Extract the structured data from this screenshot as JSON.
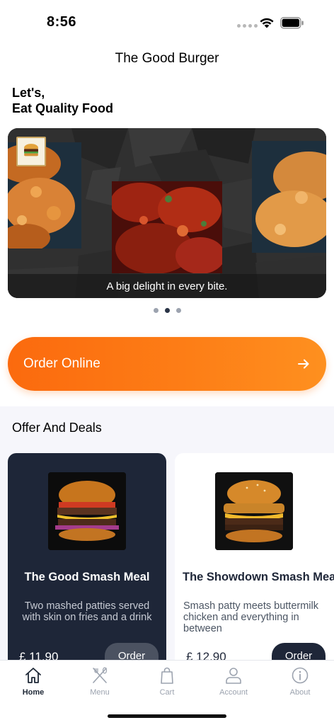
{
  "status_bar": {
    "time": "8:56"
  },
  "header": {
    "title": "The Good Burger"
  },
  "greeting": {
    "line1": "Let's,",
    "line2": "Eat Quality Food"
  },
  "carousel": {
    "caption": "A big delight in every bite.",
    "slide_count": 3,
    "active_index": 1
  },
  "order_online": {
    "label": "Order Online",
    "icon": "arrow-right-icon"
  },
  "offers": {
    "title": "Offer And Deals",
    "cards": [
      {
        "title": "The Good Smash Meal",
        "description": "Two mashed patties served with skin on fries and a drink",
        "price": "£ 11.90",
        "order_label": "Order"
      },
      {
        "title": "The Showdown Smash Meal",
        "description": "Smash patty meets buttermilk chicken and everything in between",
        "price": "£ 12.90",
        "order_label": "Order"
      }
    ]
  },
  "tab_bar": {
    "tabs": [
      {
        "label": "Home",
        "icon": "home-icon",
        "active": true
      },
      {
        "label": "Menu",
        "icon": "utensils-icon",
        "active": false
      },
      {
        "label": "Cart",
        "icon": "shopping-bag-icon",
        "active": false
      },
      {
        "label": "Account",
        "icon": "user-icon",
        "active": false
      },
      {
        "label": "About",
        "icon": "info-icon",
        "active": false
      }
    ]
  },
  "colors": {
    "accent_orange": "#fb6a0e",
    "navy": "#1e2638",
    "offer_bg": "#f6f6fb"
  }
}
